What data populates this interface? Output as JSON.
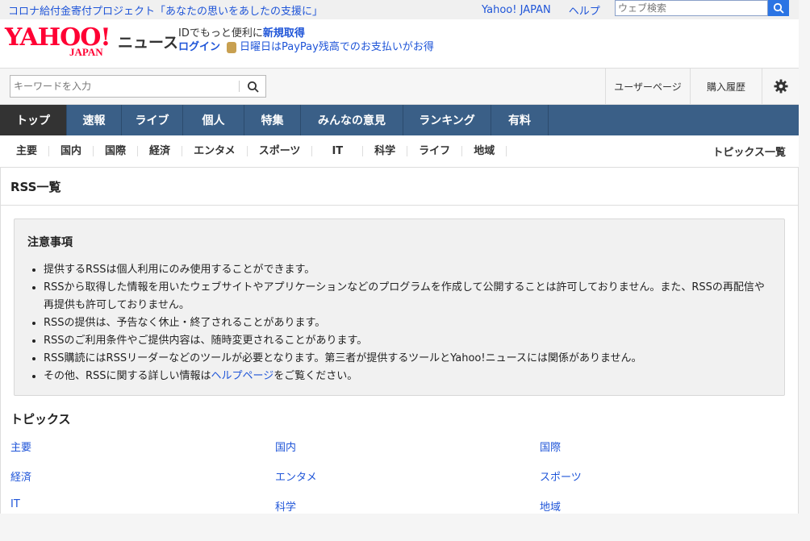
{
  "topbar": {
    "promo": "コロナ給付金寄付プロジェクト「あなたの思いをあしたの支援に」",
    "yahoo_japan": "Yahoo! JAPAN",
    "help": "ヘルプ",
    "web_search_placeholder": "ウェブ検索"
  },
  "header": {
    "logo_text": "YAHOO!",
    "logo_sub": "JAPAN",
    "section": "ニュース",
    "id_text": "IDでもっと便利に",
    "register": "新規取得",
    "login": "ログイン",
    "paypay": "日曜日はPayPay残高でのお支払いがお得"
  },
  "search": {
    "placeholder": "キーワードを入力",
    "user_page": "ユーザーページ",
    "purchase_history": "購入履歴"
  },
  "nav": [
    "トップ",
    "速報",
    "ライブ",
    "個人",
    "特集",
    "みんなの意見",
    "ランキング",
    "有料"
  ],
  "subnav": [
    "主要",
    "国内",
    "国際",
    "経済",
    "エンタメ",
    "スポーツ",
    "IT",
    "科学",
    "ライフ",
    "地域"
  ],
  "subnav_all": "トピックス一覧",
  "page_title": "RSS一覧",
  "notice": {
    "title": "注意事項",
    "items": [
      "提供するRSSは個人利用にのみ使用することができます。",
      "RSSから取得した情報を用いたウェブサイトやアプリケーションなどのプログラムを作成して公開することは許可しておりません。また、RSSの再配信や再提供も許可しておりません。",
      "RSSの提供は、予告なく休止・終了されることがあります。",
      "RSSのご利用条件やご提供内容は、随時変更されることがあります。",
      "RSS購読にはRSSリーダーなどのツールが必要となります。第三者が提供するツールとYahoo!ニュースには関係がありません。"
    ],
    "last_prefix": "その他、RSSに関する詳しい情報は",
    "last_link": "ヘルプページ",
    "last_suffix": "をご覧ください。"
  },
  "topics": {
    "title": "トピックス",
    "links": [
      "主要",
      "国内",
      "国際",
      "経済",
      "エンタメ",
      "スポーツ",
      "IT",
      "科学",
      "地域"
    ]
  }
}
